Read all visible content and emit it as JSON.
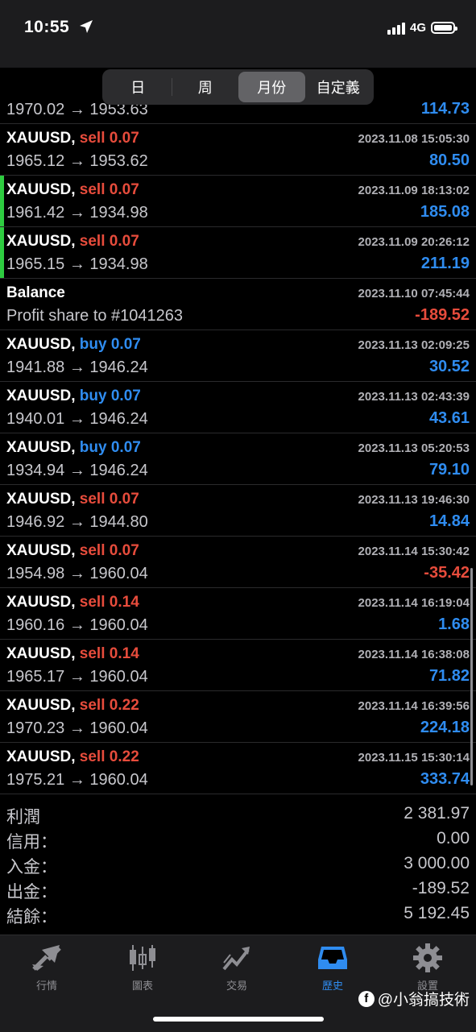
{
  "status_bar": {
    "time": "10:55",
    "network": "4G"
  },
  "period_tabs": [
    {
      "label": "日",
      "active": false
    },
    {
      "label": "周",
      "active": false
    },
    {
      "label": "月份",
      "active": true
    },
    {
      "label": "自定義",
      "active": false
    }
  ],
  "partial_row": {
    "prices": "1970.02 → 1953.63",
    "profit": "114.73"
  },
  "deals": [
    {
      "symbol": "XAUUSD,",
      "side": "sell",
      "volume": "0.07",
      "time": "2023.11.08 15:05:30",
      "prices": "1965.12 → 1953.62",
      "profit": "80.50",
      "highlight": false
    },
    {
      "symbol": "XAUUSD,",
      "side": "sell",
      "volume": "0.07",
      "time": "2023.11.09 18:13:02",
      "prices": "1961.42 → 1934.98",
      "profit": "185.08",
      "highlight": true
    },
    {
      "symbol": "XAUUSD,",
      "side": "sell",
      "volume": "0.07",
      "time": "2023.11.09 20:26:12",
      "prices": "1965.15 → 1934.98",
      "profit": "211.19",
      "highlight": true
    },
    {
      "symbol": "Balance",
      "side": "",
      "volume": "",
      "time": "2023.11.10 07:45:44",
      "prices": "Profit share to #1041263",
      "profit": "-189.52",
      "highlight": false
    },
    {
      "symbol": "XAUUSD,",
      "side": "buy",
      "volume": "0.07",
      "time": "2023.11.13 02:09:25",
      "prices": "1941.88 → 1946.24",
      "profit": "30.52",
      "highlight": false
    },
    {
      "symbol": "XAUUSD,",
      "side": "buy",
      "volume": "0.07",
      "time": "2023.11.13 02:43:39",
      "prices": "1940.01 → 1946.24",
      "profit": "43.61",
      "highlight": false
    },
    {
      "symbol": "XAUUSD,",
      "side": "buy",
      "volume": "0.07",
      "time": "2023.11.13 05:20:53",
      "prices": "1934.94 → 1946.24",
      "profit": "79.10",
      "highlight": false
    },
    {
      "symbol": "XAUUSD,",
      "side": "sell",
      "volume": "0.07",
      "time": "2023.11.13 19:46:30",
      "prices": "1946.92 → 1944.80",
      "profit": "14.84",
      "highlight": false
    },
    {
      "symbol": "XAUUSD,",
      "side": "sell",
      "volume": "0.07",
      "time": "2023.11.14 15:30:42",
      "prices": "1954.98 → 1960.04",
      "profit": "-35.42",
      "highlight": false
    },
    {
      "symbol": "XAUUSD,",
      "side": "sell",
      "volume": "0.14",
      "time": "2023.11.14 16:19:04",
      "prices": "1960.16 → 1960.04",
      "profit": "1.68",
      "highlight": false
    },
    {
      "symbol": "XAUUSD,",
      "side": "sell",
      "volume": "0.14",
      "time": "2023.11.14 16:38:08",
      "prices": "1965.17 → 1960.04",
      "profit": "71.82",
      "highlight": false
    },
    {
      "symbol": "XAUUSD,",
      "side": "sell",
      "volume": "0.22",
      "time": "2023.11.14 16:39:56",
      "prices": "1970.23 → 1960.04",
      "profit": "224.18",
      "highlight": false
    },
    {
      "symbol": "XAUUSD,",
      "side": "sell",
      "volume": "0.22",
      "time": "2023.11.15 15:30:14",
      "prices": "1975.21 → 1960.04",
      "profit": "333.74",
      "highlight": false
    }
  ],
  "summary": [
    {
      "label": "利潤",
      "value": "2 381.97"
    },
    {
      "label": "信用：",
      "value": "0.00"
    },
    {
      "label": "入金：",
      "value": "3 000.00"
    },
    {
      "label": "出金：",
      "value": "-189.52"
    },
    {
      "label": "結餘：",
      "value": "5 192.45"
    }
  ],
  "tabbar": [
    {
      "label": "行情",
      "icon": "quotes-arrows-icon",
      "active": false
    },
    {
      "label": "圖表",
      "icon": "candlestick-chart-icon",
      "active": false
    },
    {
      "label": "交易",
      "icon": "trade-chart-icon",
      "active": false
    },
    {
      "label": "歷史",
      "icon": "history-inbox-icon",
      "active": true
    },
    {
      "label": "設置",
      "icon": "gear-icon",
      "active": false
    }
  ],
  "watermark": {
    "icon_letter": "f",
    "text": "@小翁搞技術"
  },
  "colors": {
    "sell": "#e74c3c",
    "buy": "#2f8cf0",
    "profit_positive": "#2f8cf0",
    "profit_negative": "#e74c3c",
    "highlight_bar": "#2ecc40",
    "active_tab": "#2f8cf0"
  }
}
